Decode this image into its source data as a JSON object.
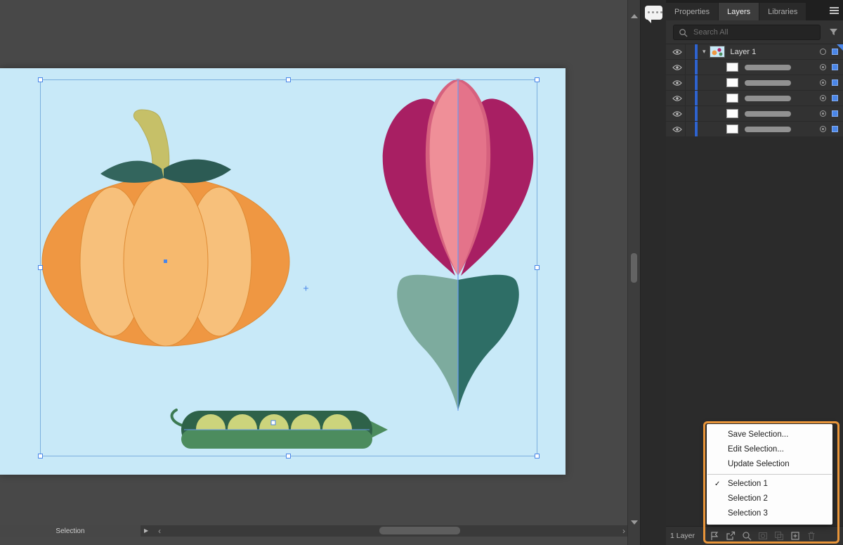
{
  "canvas": {
    "statusbar": {
      "mode_label": "Selection"
    }
  },
  "panel": {
    "tabs": [
      {
        "label": "Properties"
      },
      {
        "label": "Layers"
      },
      {
        "label": "Libraries"
      }
    ],
    "search": {
      "placeholder": "Search All"
    },
    "layers": {
      "layer1_name": "Layer 1"
    },
    "footer": {
      "count": "1 Layer"
    }
  },
  "context_menu": {
    "items": [
      {
        "label": "Save Selection..."
      },
      {
        "label": "Edit Selection..."
      },
      {
        "label": "Update Selection"
      }
    ],
    "selections": [
      {
        "label": "Selection 1",
        "checked": true
      },
      {
        "label": "Selection 2",
        "checked": false
      },
      {
        "label": "Selection 3",
        "checked": false
      }
    ]
  },
  "icons": {
    "check": "✓",
    "chevron_down": "▾",
    "play": "▶",
    "chevron_left": "‹",
    "chevron_right": "›"
  },
  "colors": {
    "highlight_orange": "#E8953A",
    "selection_blue": "#4A86E8",
    "layer_color_blue": "#2E63CF",
    "artboard_blue": "#C8E9F8"
  }
}
